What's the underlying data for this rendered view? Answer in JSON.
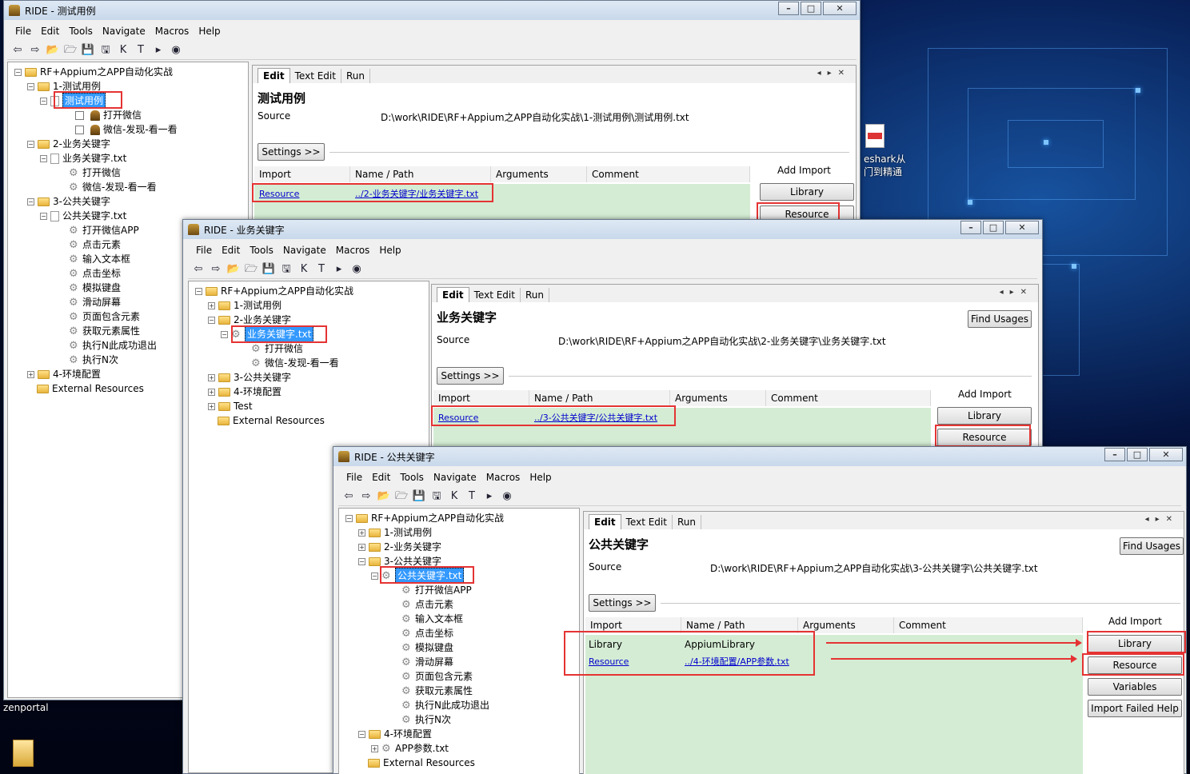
{
  "desktop": {
    "icon1_label_line1": "eshark从",
    "icon1_label_line2": "门到精通",
    "icon2_label": "zenportal"
  },
  "menu": [
    "File",
    "Edit",
    "Tools",
    "Navigate",
    "Macros",
    "Help"
  ],
  "tabs": [
    "Edit",
    "Text Edit",
    "Run"
  ],
  "grid_headers": [
    "Import",
    "Name / Path",
    "Arguments",
    "Comment"
  ],
  "buttons": {
    "settings": "Settings >>",
    "add_import": "Add Import",
    "library": "Library",
    "resource": "Resource",
    "variables": "Variables",
    "import_failed": "Import Failed Help",
    "find_usages": "Find Usages"
  },
  "source_label": "Source",
  "win1": {
    "title": "RIDE - 测试用例",
    "tree": {
      "root": "RF+Appium之APP自动化实战",
      "n1": "1-测试用例",
      "n1_1": "测试用例",
      "n1_1_1": "打开微信",
      "n1_1_2": "微信-发现-看一看",
      "n2": "2-业务关键字",
      "n2_1": "业务关键字.txt",
      "n2_1_1": "打开微信",
      "n2_1_2": "微信-发现-看一看",
      "n3": "3-公共关键字",
      "n3_1": "公共关键字.txt",
      "k1": "打开微信APP",
      "k2": "点击元素",
      "k3": "输入文本框",
      "k4": "点击坐标",
      "k5": "模拟键盘",
      "k6": "滑动屏幕",
      "k7": "页面包含元素",
      "k8": "获取元素属性",
      "k9": "执行N此成功退出",
      "k10": "执行N次",
      "n4": "4-环境配置",
      "ext": "External Resources"
    },
    "editor_title": "测试用例",
    "source": "D:\\work\\RIDE\\RF+Appium之APP自动化实战\\1-测试用例\\测试用例.txt",
    "import_row": {
      "type": "Resource",
      "path": "../2-业务关键字/业务关键字.txt"
    }
  },
  "win2": {
    "title": "RIDE - 业务关键字",
    "tree": {
      "root": "RF+Appium之APP自动化实战",
      "n1": "1-测试用例",
      "n2": "2-业务关键字",
      "n2_1": "业务关键字.txt",
      "n2_1_1": "打开微信",
      "n2_1_2": "微信-发现-看一看",
      "n3": "3-公共关键字",
      "n4": "4-环境配置",
      "test": "Test",
      "ext": "External Resources"
    },
    "editor_title": "业务关键字",
    "source": "D:\\work\\RIDE\\RF+Appium之APP自动化实战\\2-业务关键字\\业务关键字.txt",
    "import_row": {
      "type": "Resource",
      "path": "../3-公共关键字/公共关键字.txt"
    }
  },
  "win3": {
    "title": "RIDE - 公共关键字",
    "tree": {
      "root": "RF+Appium之APP自动化实战",
      "n1": "1-测试用例",
      "n2": "2-业务关键字",
      "n3": "3-公共关键字",
      "n3_1": "公共关键字.txt",
      "k1": "打开微信APP",
      "k2": "点击元素",
      "k3": "输入文本框",
      "k4": "点击坐标",
      "k5": "模拟键盘",
      "k6": "滑动屏幕",
      "k7": "页面包含元素",
      "k8": "获取元素属性",
      "k9": "执行N此成功退出",
      "k10": "执行N次",
      "n4": "4-环境配置",
      "n4_1": "APP参数.txt",
      "ext": "External Resources"
    },
    "editor_title": "公共关键字",
    "source": "D:\\work\\RIDE\\RF+Appium之APP自动化实战\\3-公共关键字\\公共关键字.txt",
    "import_rows": [
      {
        "type": "Library",
        "path": "AppiumLibrary"
      },
      {
        "type": "Resource",
        "path": "../4-环境配置/APP参数.txt"
      }
    ]
  }
}
